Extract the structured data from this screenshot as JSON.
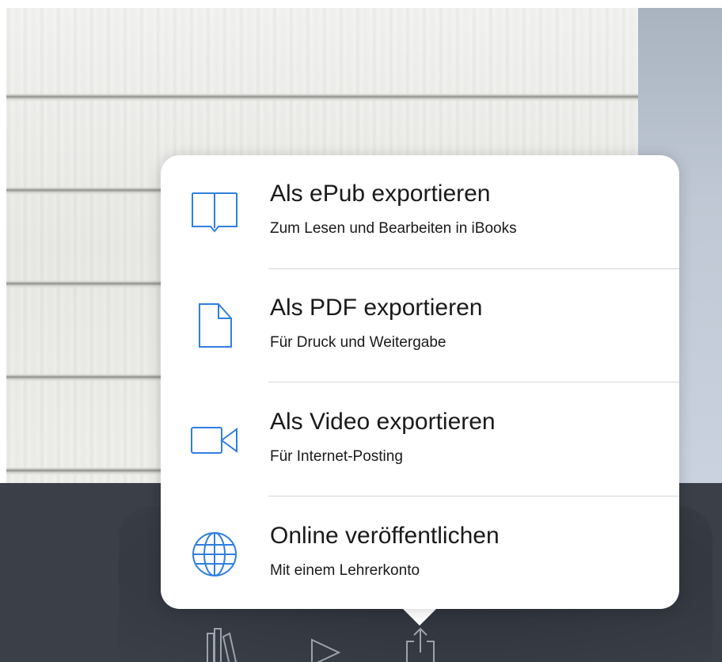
{
  "export_menu": {
    "items": [
      {
        "title": "Als ePub exportieren",
        "subtitle": "Zum Lesen und Bearbeiten in iBooks",
        "icon": "book-icon"
      },
      {
        "title": "Als PDF exportieren",
        "subtitle": "Für Druck und Weitergabe",
        "icon": "document-icon"
      },
      {
        "title": "Als Video exportieren",
        "subtitle": "Für Internet-Posting",
        "icon": "video-camera-icon"
      },
      {
        "title": "Online veröffentlichen",
        "subtitle": "Mit einem Lehrerkonto",
        "icon": "globe-icon"
      }
    ]
  },
  "toolbar": {
    "icons": [
      "library-icon",
      "play-icon",
      "share-icon"
    ]
  },
  "colors": {
    "accent": "#2f7fe0",
    "toolbar_background": "#3a3f48",
    "toolbar_icon": "#9aa3ae"
  }
}
